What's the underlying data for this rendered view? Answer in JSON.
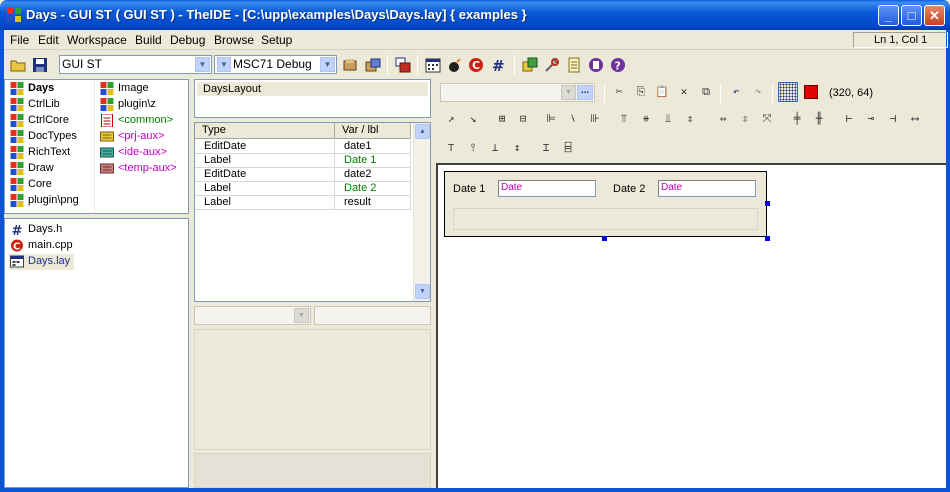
{
  "window": {
    "title": "Days - GUI ST ( GUI ST ) - TheIDE - [C:\\upp\\examples\\Days\\Days.lay] { examples }",
    "minimize": "_",
    "maximize": "□",
    "close": "✕"
  },
  "menu": [
    "File",
    "Edit",
    "Workspace",
    "Build",
    "Debug",
    "Browse",
    "Setup"
  ],
  "status": {
    "position": "Ln 1, Col 1"
  },
  "toolbar": {
    "main_config": "GUI ST",
    "build_method": "MSC71 Debug"
  },
  "packages": {
    "col1": [
      {
        "label": "Days",
        "icon": "package-icon",
        "bold": true
      },
      {
        "label": "CtrlLib",
        "icon": "package-icon"
      },
      {
        "label": "CtrlCore",
        "icon": "package-icon"
      },
      {
        "label": "DocTypes",
        "icon": "package-icon"
      },
      {
        "label": "RichText",
        "icon": "package-icon"
      },
      {
        "label": "Draw",
        "icon": "package-icon"
      },
      {
        "label": "Core",
        "icon": "package-icon"
      },
      {
        "label": "plugin\\png",
        "icon": "package-icon"
      }
    ],
    "col2": [
      {
        "label": "Image",
        "icon": "package-icon"
      },
      {
        "label": "plugin\\z",
        "icon": "package-icon"
      },
      {
        "label": "<common>",
        "icon": "common-icon",
        "color": "#008000"
      },
      {
        "label": "<prj-aux>",
        "icon": "prj-aux-icon",
        "color": "#C000C0"
      },
      {
        "label": "<ide-aux>",
        "icon": "ide-aux-icon",
        "color": "#C000C0"
      },
      {
        "label": "<temp-aux>",
        "icon": "temp-aux-icon",
        "color": "#C000C0"
      }
    ]
  },
  "files": [
    {
      "label": "Days.h",
      "icon": "header-file-icon"
    },
    {
      "label": "main.cpp",
      "icon": "cpp-file-icon"
    },
    {
      "label": "Days.lay",
      "icon": "layout-file-icon",
      "selected": true
    }
  ],
  "layouts": [
    "DaysLayout"
  ],
  "items_table": {
    "headers": [
      "Type",
      "Var / lbl"
    ],
    "rows": [
      {
        "type": "EditDate",
        "var": "date1",
        "green": false
      },
      {
        "type": "Label",
        "var": "Date 1",
        "green": true
      },
      {
        "type": "EditDate",
        "var": "date2",
        "green": false
      },
      {
        "type": "Label",
        "var": "Date 2",
        "green": true
      },
      {
        "type": "Label",
        "var": "result",
        "green": false
      }
    ]
  },
  "editor": {
    "coords": "(320, 64)",
    "ellipsis": "..."
  },
  "layout_preview": {
    "label1": "Date 1",
    "field1_placeholder": "Date",
    "label2": "Date 2",
    "field2_placeholder": "Date"
  },
  "colors": {
    "title_bar": "#0A5FD8",
    "label_green": "#008000",
    "aux_magenta": "#C000C0",
    "selection": "#0000E0"
  }
}
